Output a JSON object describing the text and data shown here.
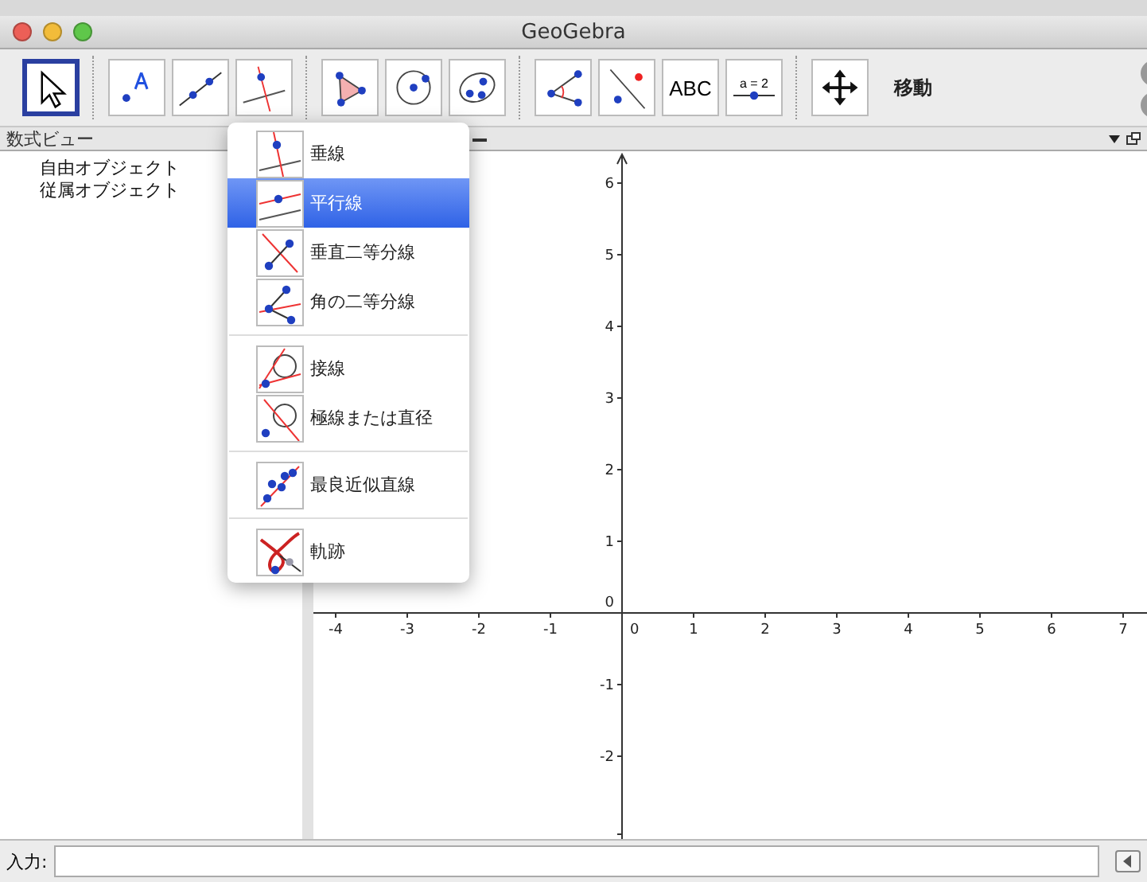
{
  "window": {
    "title": "GeoGebra"
  },
  "toolbar": {
    "tools": [
      {
        "kind": "move",
        "selected": true
      },
      {
        "kind": "point",
        "selected": false
      },
      {
        "kind": "line",
        "selected": false
      },
      {
        "kind": "perpendicular",
        "selected": false
      },
      {
        "kind": "polygon",
        "selected": false
      },
      {
        "kind": "circle",
        "selected": false
      },
      {
        "kind": "conic",
        "selected": false
      },
      {
        "kind": "angle",
        "selected": false
      },
      {
        "kind": "reflect",
        "selected": false
      },
      {
        "kind": "text",
        "text": "ABC",
        "selected": false
      },
      {
        "kind": "slider",
        "text": "a = 2",
        "selected": false
      },
      {
        "kind": "move-view",
        "selected": false
      }
    ],
    "tool_name": "移動"
  },
  "algebra_view": {
    "title": "数式ビュー",
    "items": [
      "自由オブジェクト",
      "従属オブジェクト"
    ]
  },
  "graphics_view": {
    "x_ticks": [
      "-4",
      "-3",
      "-2",
      "-1",
      "0",
      "1",
      "2",
      "3",
      "4",
      "5",
      "6",
      "7"
    ],
    "y_ticks": [
      "6",
      "5",
      "4",
      "3",
      "2",
      "1",
      "0",
      "-1",
      "-2"
    ]
  },
  "tool_menu": {
    "groups": [
      [
        {
          "kind": "perpendicular",
          "label": "垂線",
          "selected": false
        },
        {
          "kind": "parallel",
          "label": "平行線",
          "selected": true
        },
        {
          "kind": "bisector",
          "label": "垂直二等分線",
          "selected": false
        },
        {
          "kind": "angle-bisector",
          "label": "角の二等分線",
          "selected": false
        }
      ],
      [
        {
          "kind": "tangent",
          "label": "接線",
          "selected": false
        },
        {
          "kind": "polar",
          "label": "極線または直径",
          "selected": false
        }
      ],
      [
        {
          "kind": "fit",
          "label": "最良近似直線",
          "selected": false
        }
      ],
      [
        {
          "kind": "locus",
          "label": "軌跡",
          "selected": false
        }
      ]
    ]
  },
  "input_bar": {
    "label": "入力:"
  }
}
